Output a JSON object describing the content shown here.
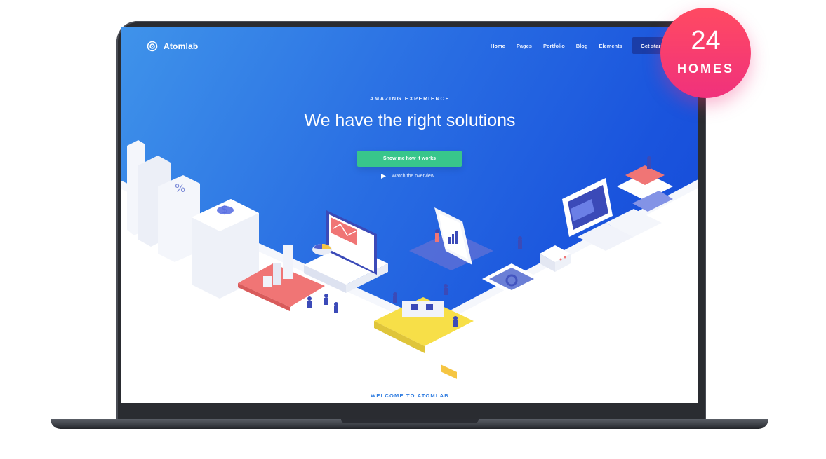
{
  "app": {
    "logo_text": "Atomlab"
  },
  "nav": {
    "items": [
      {
        "label": "Home",
        "active": true
      },
      {
        "label": "Pages",
        "active": false
      },
      {
        "label": "Portfolio",
        "active": false
      },
      {
        "label": "Blog",
        "active": false
      },
      {
        "label": "Elements",
        "active": false
      }
    ],
    "search_icon": "search-icon",
    "cta_label": "Get star"
  },
  "hero": {
    "eyebrow": "AMAZING EXPERIENCE",
    "headline": "We have the right solutions",
    "primary_button": "Show me how it works",
    "watch_label": "Watch the overview"
  },
  "section": {
    "title": "WELCOME TO ATOMLAB"
  },
  "badge": {
    "number": "24",
    "label": "HOMES"
  },
  "colors": {
    "hero_blue": "#1a54dd",
    "accent_green": "#38c68b",
    "badge_pink": "#f0317c",
    "section_blue": "#2d7be0"
  }
}
